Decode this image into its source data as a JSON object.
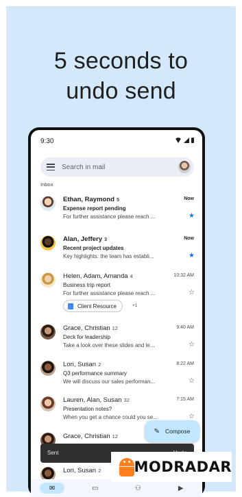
{
  "headline": {
    "line1": "5 seconds to",
    "line2": "undo send"
  },
  "status_bar": {
    "time": "9:30"
  },
  "search": {
    "placeholder": "Search in mail"
  },
  "inbox_label": "Inbox",
  "emails": [
    {
      "sender": "Ethan, Raymond",
      "count": "5",
      "time": "Now",
      "subject": "Expense report pending",
      "snippet": "For further assistance please reach ...",
      "starred": true,
      "unread": true
    },
    {
      "sender": "Alan, Jeffery",
      "count": "3",
      "time": "Now",
      "subject": "Recent project updates",
      "snippet": "Key highlights: the team has establi...",
      "starred": true,
      "unread": true
    },
    {
      "sender": "Helen, Adam, Amanda",
      "count": "4",
      "time": "10:32 AM",
      "subject": "Business trip report",
      "snippet": "For further assistance please reach ...",
      "starred": false,
      "unread": false,
      "attachment": "Client Resource",
      "attachment_more": "+1"
    },
    {
      "sender": "Grace, Christian",
      "count": "12",
      "time": "9:40 AM",
      "subject": "Deck for leadership",
      "snippet": "Take a look over these slides and le...",
      "starred": false,
      "unread": false
    },
    {
      "sender": "Lori, Susan",
      "count": "2",
      "time": "8:22 AM",
      "subject": "Q3 performance summary",
      "snippet": "We will discuss our sales performan...",
      "starred": false,
      "unread": false
    },
    {
      "sender": "Lauren, Alan, Susan",
      "count": "32",
      "time": "7:15 AM",
      "subject": "Presentation notes?",
      "snippet": "When you get a chance could you se...",
      "starred": false,
      "unread": false
    },
    {
      "sender": "Grace, Christian",
      "count": "12",
      "time": "",
      "subject": "",
      "snippet": "",
      "starred": false,
      "unread": false
    },
    {
      "sender": "Lori, Susan",
      "count": "2",
      "time": "",
      "subject": "",
      "snippet": "",
      "starred": false,
      "unread": false
    }
  ],
  "compose": {
    "label": "Compose"
  },
  "snackbar": {
    "message": "Sent",
    "action": "Undo"
  },
  "watermark": {
    "text": "MODRADAR"
  },
  "colors": {
    "background": "#d3e8fb",
    "accent": "#c2e7ff",
    "star": "#1a73e8",
    "android": "#ff7f1f"
  },
  "icons": {
    "nav": [
      "mail-icon",
      "chat-icon",
      "spaces-icon",
      "meet-icon"
    ]
  }
}
